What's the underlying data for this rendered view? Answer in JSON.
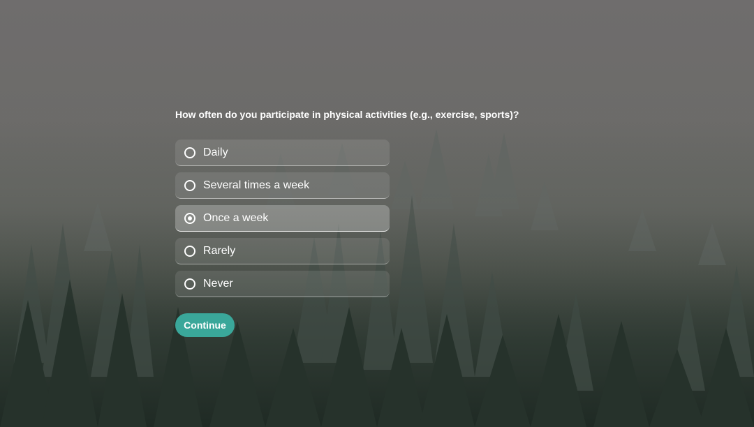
{
  "survey": {
    "question": "How often do you participate in physical activities (e.g., exercise, sports)?",
    "options": [
      {
        "label": "Daily",
        "selected": false
      },
      {
        "label": "Several times a week",
        "selected": false
      },
      {
        "label": "Once a week",
        "selected": true
      },
      {
        "label": "Rarely",
        "selected": false
      },
      {
        "label": "Never",
        "selected": false
      }
    ],
    "continue_label": "Continue"
  },
  "colors": {
    "accent": "#3aa79a",
    "text": "#ffffff"
  }
}
